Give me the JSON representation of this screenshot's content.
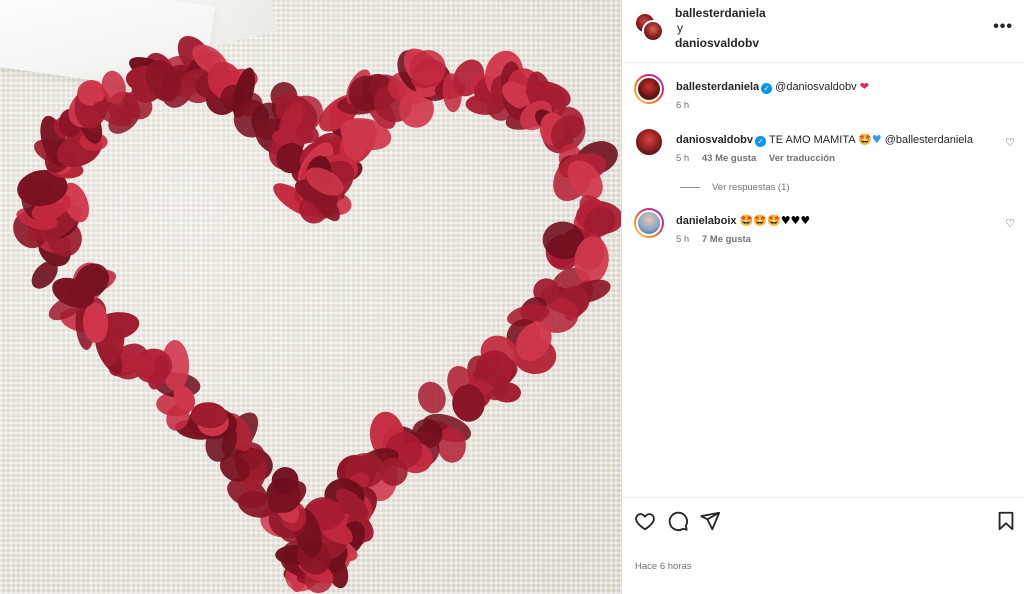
{
  "post": {
    "author1": "ballesterdaniela",
    "conjunction": "y",
    "author2": "daniosvaldobv",
    "more_label": "•••",
    "timestamp": "Hace 6 horas"
  },
  "caption": {
    "user": "ballesterdaniela",
    "text": "@daniosvaldobv",
    "emoji": "❤",
    "time": "6 h"
  },
  "comments": [
    {
      "user": "daniosvaldobv",
      "text": "TE AMO MAMITA",
      "emoji_face": "🤩",
      "emoji_heart": "♥",
      "mention": "@ballesterdaniela",
      "time": "5 h",
      "likes": "43 Me gusta",
      "translate": "Ver traducción",
      "replies": "Ver respuestas (1)"
    },
    {
      "user": "danielaboix",
      "text": "🤩🤩🤩",
      "hearts": "♥♥♥",
      "time": "5 h",
      "likes": "7 Me gusta"
    }
  ],
  "icons": {
    "like": "heart-outline-icon",
    "comment": "comment-icon",
    "share": "share-icon",
    "save": "bookmark-icon",
    "more": "more-horizontal-icon",
    "verified": "verified-badge-icon"
  },
  "colors": {
    "verified": "#0095f6",
    "muted_text": "#737373",
    "petal": "#9e1c2e"
  }
}
